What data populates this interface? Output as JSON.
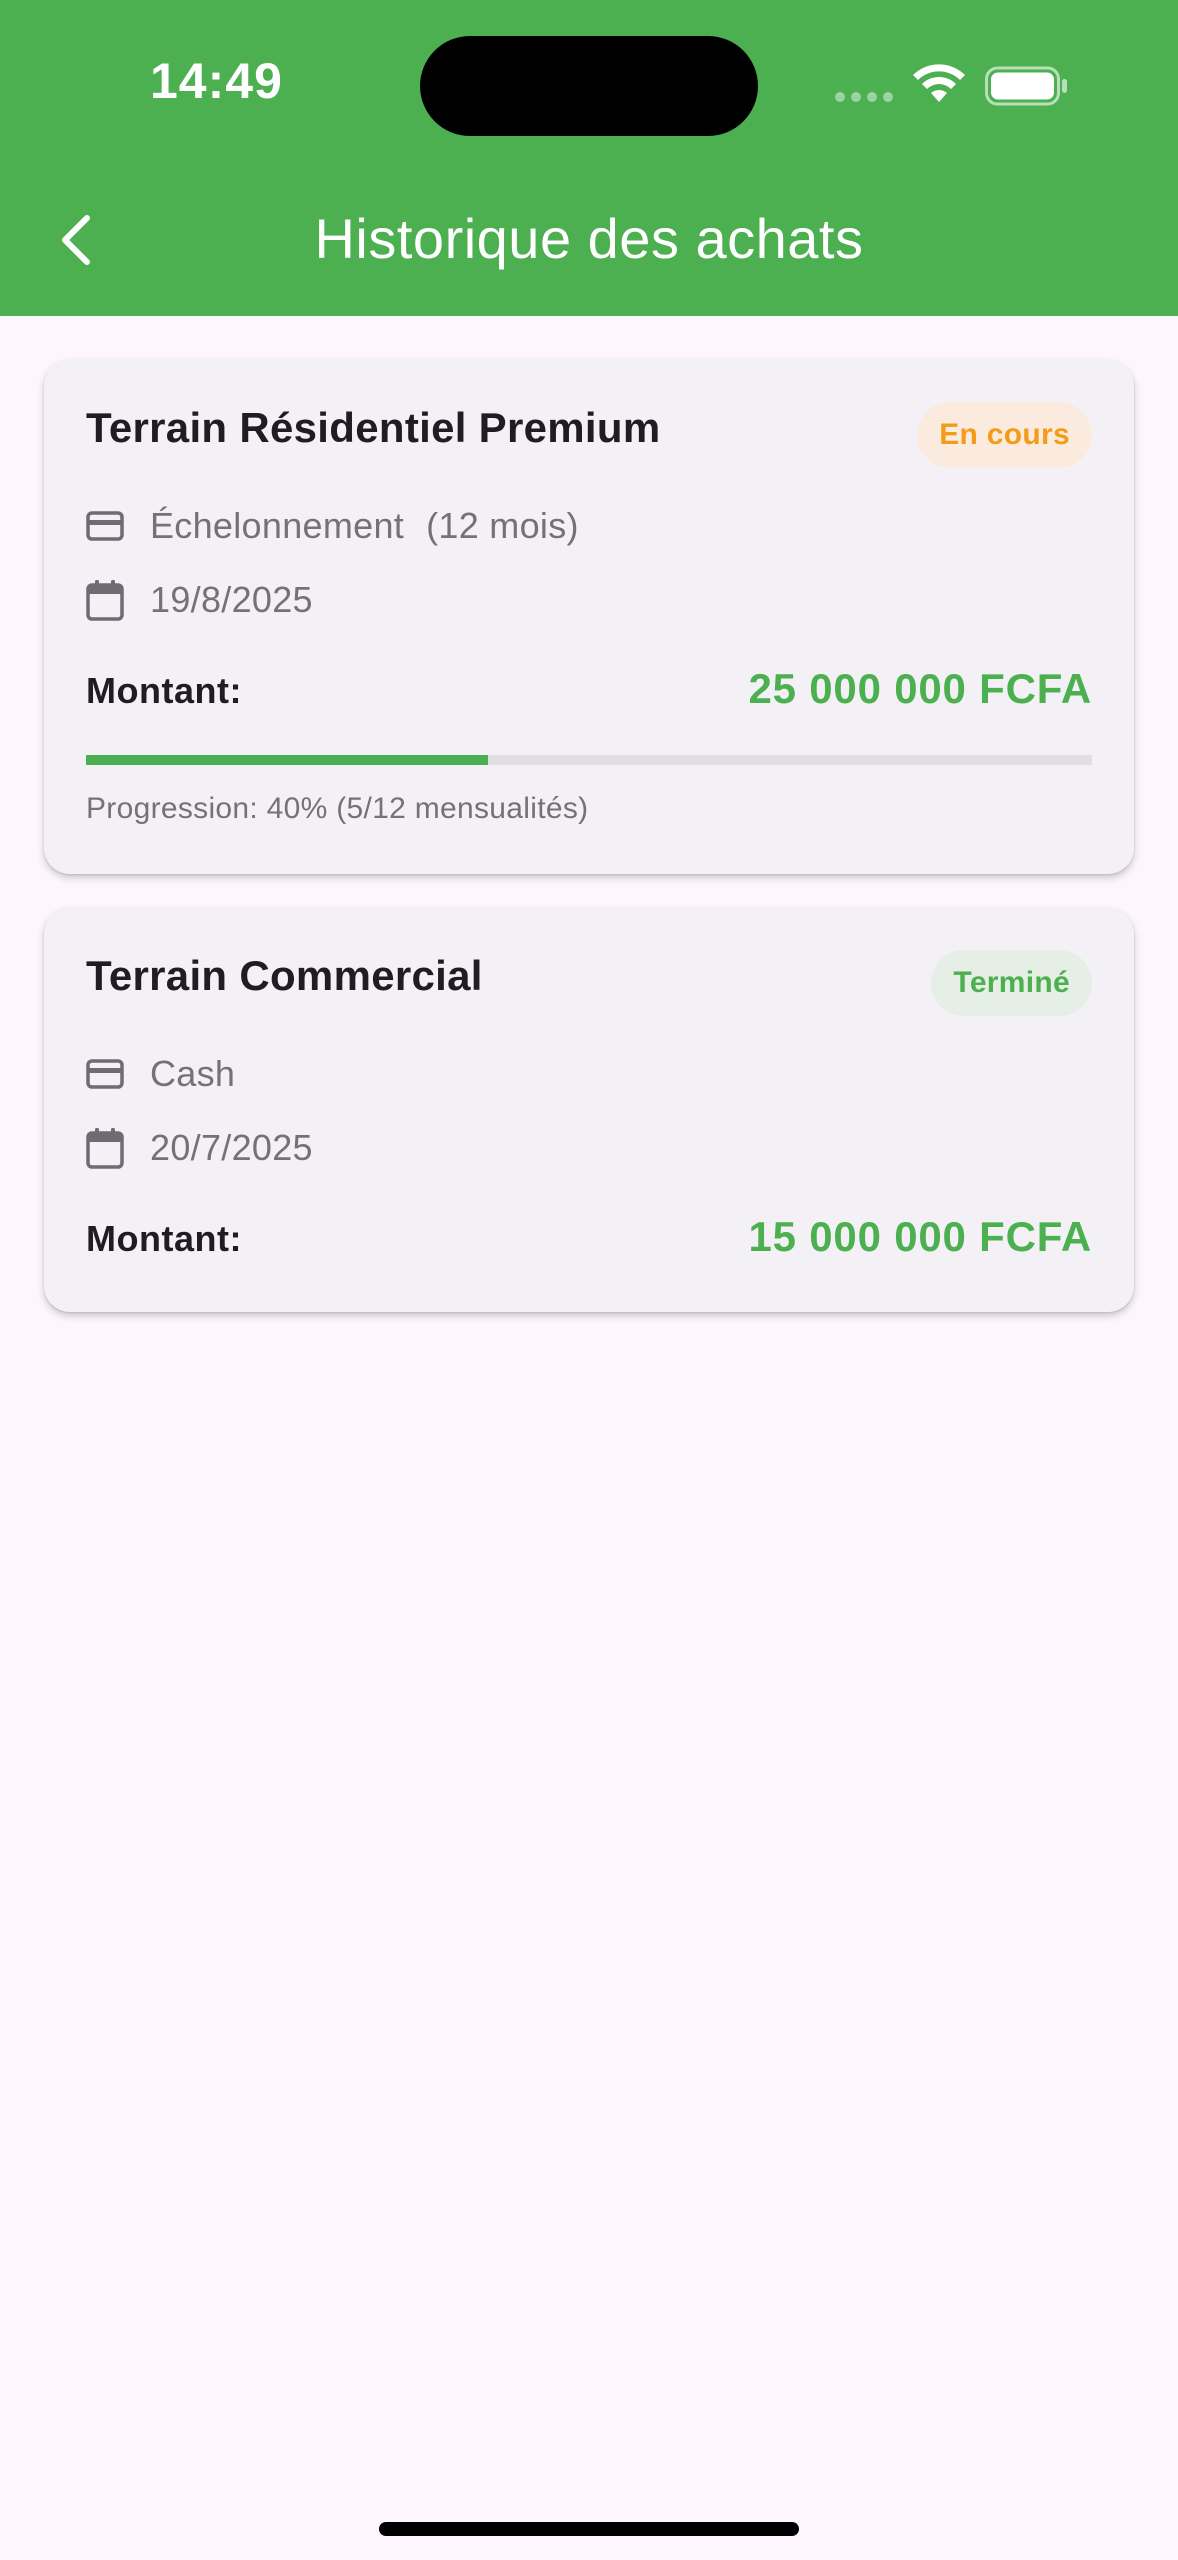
{
  "status_bar": {
    "time": "14:49"
  },
  "header": {
    "title": "Historique des achats",
    "color": "#4CAF50"
  },
  "purchases": [
    {
      "title": "Terrain Résidentiel Premium",
      "status": "En cours",
      "status_color": "#F39C1A",
      "payment_icon": "credit-card-icon",
      "payment_type": "Échelonnement",
      "payment_detail": "(12 mois)",
      "date_icon": "calendar-icon",
      "date": "19/8/2025",
      "amount_label": "Montant:",
      "amount": "25 000 000 FCFA",
      "progress_fraction": 0.4,
      "progress_text": "Progression: 40% (5/12 mensualités)"
    },
    {
      "title": "Terrain Commercial",
      "status": "Terminé",
      "status_color": "#4CAF50",
      "payment_icon": "credit-card-icon",
      "payment_type": "Cash",
      "date_icon": "calendar-icon",
      "date": "20/7/2025",
      "amount_label": "Montant:",
      "amount": "15 000 000 FCFA"
    }
  ]
}
